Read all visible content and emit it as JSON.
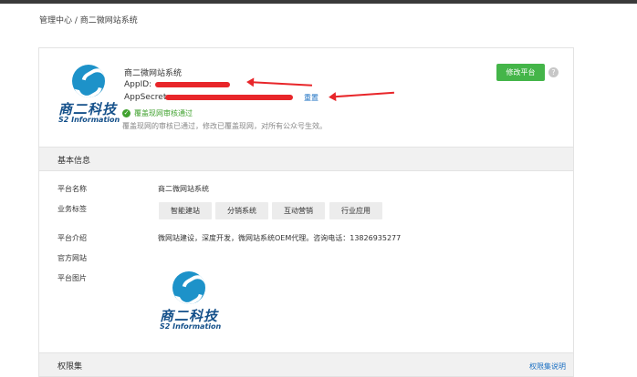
{
  "breadcrumb": "管理中心 / 商二微网站系统",
  "header": {
    "app_name": "商二微网站系统",
    "app_id_label": "AppID:",
    "app_secret_label": "AppSecret:",
    "reset_label": "重置",
    "verify_status": "覆盖现网审核通过",
    "verify_note": "覆盖现网的审核已通过，修改已覆盖现网，对所有公众号生效。",
    "edit_button": "修改平台",
    "help_icon": "question-icon"
  },
  "logo": {
    "cn": "商二科技",
    "en": "S2 Information"
  },
  "basic_info": {
    "section_title": "基本信息",
    "platform_name_label": "平台名称",
    "platform_name_value": "商二微网站系统",
    "business_tags_label": "业务标签",
    "tags": [
      "智能建站",
      "分销系统",
      "互动营销",
      "行业应用"
    ],
    "intro_label": "平台介绍",
    "intro_value": "微网站建设，深度开发，微网站系统OEM代理。咨询电话：13826935277",
    "website_label": "官方网站",
    "image_label": "平台图片"
  },
  "permissions": {
    "section_title": "权限集",
    "link": "权限集说明"
  },
  "colors": {
    "accent_green": "#44b549",
    "link_blue": "#1a6fc2",
    "annotation_red": "#e8262a",
    "logo_blue": "#1d92c9"
  }
}
